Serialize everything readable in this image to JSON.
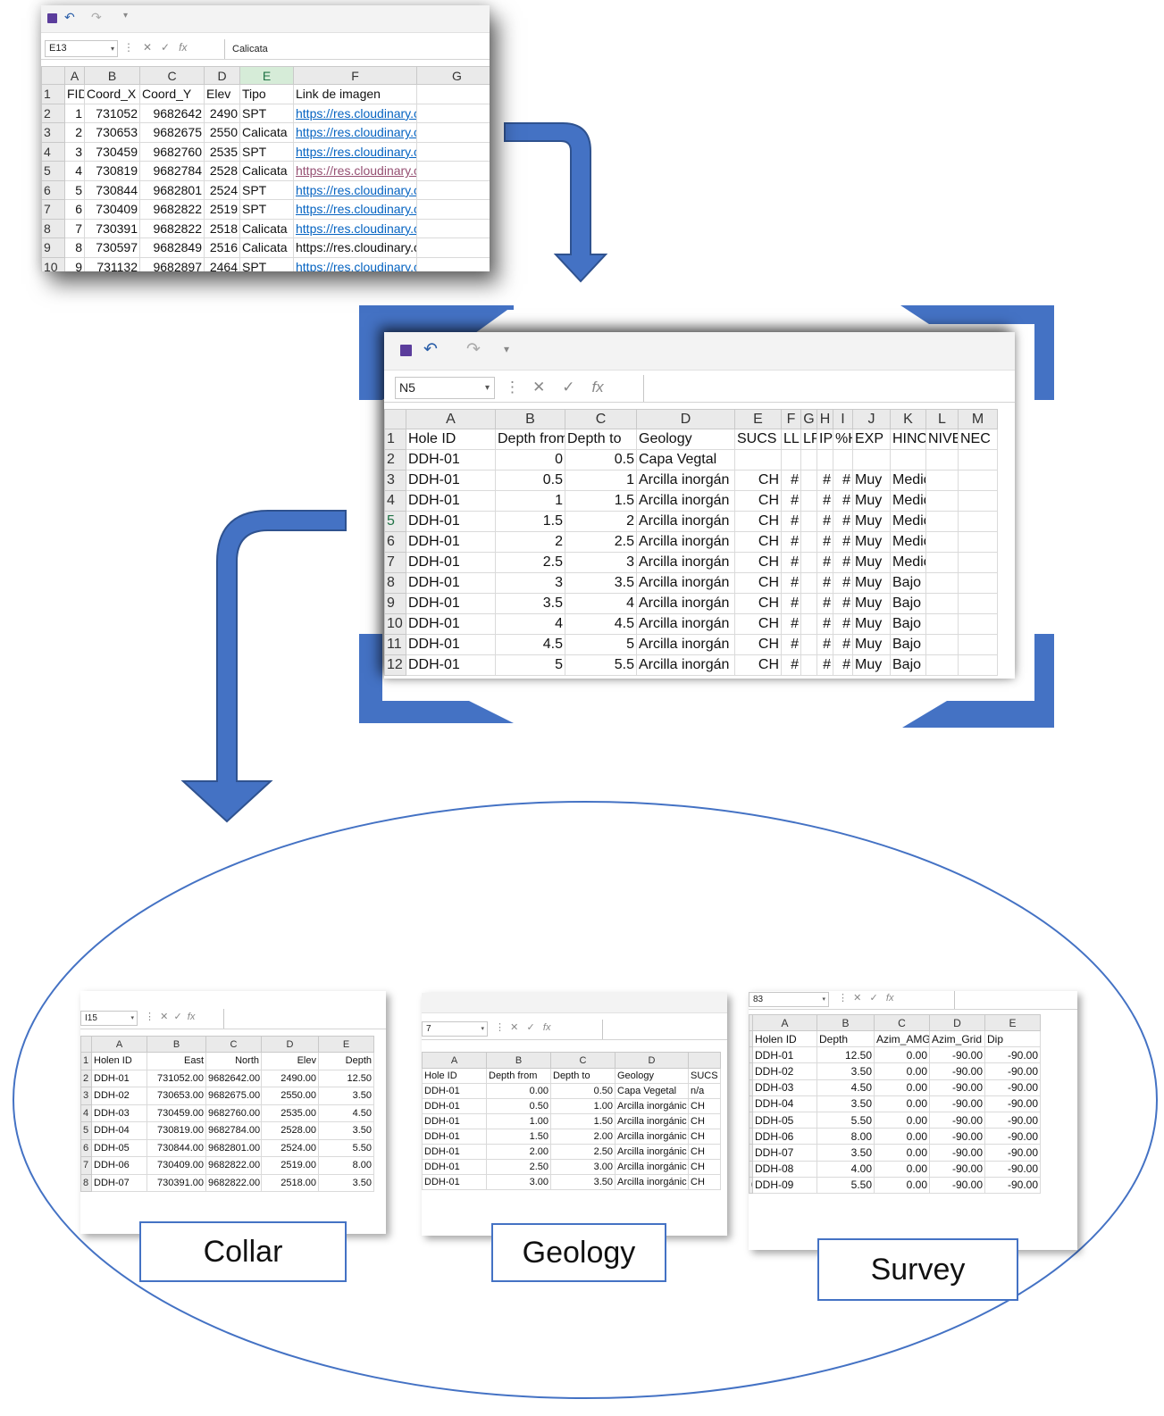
{
  "theme": {
    "arrow": "#4472c4",
    "arrow_outline": "#2f528f",
    "link": "#0563c1",
    "visited": "#954f72",
    "excel_green": "#217346"
  },
  "sheet1": {
    "namebox": "E13",
    "formula": "Calicata",
    "columns": [
      "A",
      "B",
      "C",
      "D",
      "E",
      "F",
      "G"
    ],
    "rows": [
      {
        "n": "1",
        "cells": [
          "FID",
          "Coord_X",
          "Coord_Y",
          "Elev",
          "Tipo",
          "Link de imagen",
          ""
        ]
      },
      {
        "n": "2",
        "cells": [
          "1",
          "731052",
          "9682642",
          "2490",
          "SPT",
          "https://res.cloudinary.com/dkfle",
          ""
        ]
      },
      {
        "n": "3",
        "cells": [
          "2",
          "730653",
          "9682675",
          "2550",
          "Calicata",
          "https://res.cloudinary.com/dkfle",
          ""
        ]
      },
      {
        "n": "4",
        "cells": [
          "3",
          "730459",
          "9682760",
          "2535",
          "SPT",
          "https://res.cloudinary.com/dkfle",
          ""
        ]
      },
      {
        "n": "5",
        "cells": [
          "4",
          "730819",
          "9682784",
          "2528",
          "Calicata",
          "https://res.cloudinary.com/dkfle",
          ""
        ]
      },
      {
        "n": "6",
        "cells": [
          "5",
          "730844",
          "9682801",
          "2524",
          "SPT",
          "https://res.cloudinary.com/dkfle",
          ""
        ]
      },
      {
        "n": "7",
        "cells": [
          "6",
          "730409",
          "9682822",
          "2519",
          "SPT",
          "https://res.cloudinary.com/dkfle",
          ""
        ]
      },
      {
        "n": "8",
        "cells": [
          "7",
          "730391",
          "9682822",
          "2518",
          "Calicata",
          "https://res.cloudinary.com/dkfle",
          ""
        ]
      },
      {
        "n": "9",
        "cells": [
          "8",
          "730597",
          "9682849",
          "2516",
          "Calicata",
          "https://res.cloudinary.com/dkfle",
          ""
        ]
      },
      {
        "n": "10",
        "cells": [
          "9",
          "731132",
          "9682897",
          "2464",
          "SPT",
          "https://res.cloudinary.com/dkfle",
          ""
        ]
      }
    ]
  },
  "sheet2": {
    "namebox": "N5",
    "formula": "",
    "columns": [
      "A",
      "B",
      "C",
      "D",
      "E",
      "F",
      "G",
      "H",
      "I",
      "J",
      "K",
      "L",
      "M"
    ],
    "rows": [
      {
        "n": "1",
        "cells": [
          "Hole ID",
          "Depth from",
          "Depth to",
          "Geology",
          "SUCS",
          "LL",
          "LP",
          "IP",
          "%H",
          "EXP",
          "HINC",
          "NIVE",
          "NEC"
        ]
      },
      {
        "n": "2",
        "cells": [
          "DDH-01",
          "0",
          "0.5",
          "Capa Vegtal",
          "",
          "",
          "",
          "",
          "",
          "",
          "",
          "",
          ""
        ]
      },
      {
        "n": "3",
        "cells": [
          "DDH-01",
          "0.5",
          "1",
          "Arcilla inorgán",
          "CH",
          "#",
          "",
          "#",
          "#",
          "Muy",
          "Medio",
          "",
          ""
        ]
      },
      {
        "n": "4",
        "cells": [
          "DDH-01",
          "1",
          "1.5",
          "Arcilla inorgán",
          "CH",
          "#",
          "",
          "#",
          "#",
          "Muy",
          "Medio",
          "",
          ""
        ]
      },
      {
        "n": "5",
        "cells": [
          "DDH-01",
          "1.5",
          "2",
          "Arcilla inorgán",
          "CH",
          "#",
          "",
          "#",
          "#",
          "Muy",
          "Medio",
          "",
          ""
        ]
      },
      {
        "n": "6",
        "cells": [
          "DDH-01",
          "2",
          "2.5",
          "Arcilla inorgán",
          "CH",
          "#",
          "",
          "#",
          "#",
          "Muy",
          "Medio",
          "",
          ""
        ]
      },
      {
        "n": "7",
        "cells": [
          "DDH-01",
          "2.5",
          "3",
          "Arcilla inorgán",
          "CH",
          "#",
          "",
          "#",
          "#",
          "Muy",
          "Medio",
          "",
          ""
        ]
      },
      {
        "n": "8",
        "cells": [
          "DDH-01",
          "3",
          "3.5",
          "Arcilla inorgán",
          "CH",
          "#",
          "",
          "#",
          "#",
          "Muy",
          "Bajo",
          "",
          ""
        ]
      },
      {
        "n": "9",
        "cells": [
          "DDH-01",
          "3.5",
          "4",
          "Arcilla inorgán",
          "CH",
          "#",
          "",
          "#",
          "#",
          "Muy",
          "Bajo",
          "",
          ""
        ]
      },
      {
        "n": "10",
        "cells": [
          "DDH-01",
          "4",
          "4.5",
          "Arcilla inorgán",
          "CH",
          "#",
          "",
          "#",
          "#",
          "Muy",
          "Bajo",
          "",
          ""
        ]
      },
      {
        "n": "11",
        "cells": [
          "DDH-01",
          "4.5",
          "5",
          "Arcilla inorgán",
          "CH",
          "#",
          "",
          "#",
          "#",
          "Muy",
          "Bajo",
          "",
          ""
        ]
      },
      {
        "n": "12",
        "cells": [
          "DDH-01",
          "5",
          "5.5",
          "Arcilla inorgán",
          "CH",
          "#",
          "",
          "#",
          "#",
          "Muy",
          "Bajo",
          "",
          ""
        ]
      }
    ]
  },
  "collar": {
    "label": "Collar",
    "namebox": "I15",
    "columns": [
      "A",
      "B",
      "C",
      "D",
      "E"
    ],
    "rows": [
      {
        "n": "1",
        "cells": [
          "Holen ID",
          "East",
          "North",
          "Elev",
          "Depth"
        ]
      },
      {
        "n": "2",
        "cells": [
          "DDH-01",
          "731052.00",
          "9682642.00",
          "2490.00",
          "12.50"
        ]
      },
      {
        "n": "3",
        "cells": [
          "DDH-02",
          "730653.00",
          "9682675.00",
          "2550.00",
          "3.50"
        ]
      },
      {
        "n": "4",
        "cells": [
          "DDH-03",
          "730459.00",
          "9682760.00",
          "2535.00",
          "4.50"
        ]
      },
      {
        "n": "5",
        "cells": [
          "DDH-04",
          "730819.00",
          "9682784.00",
          "2528.00",
          "3.50"
        ]
      },
      {
        "n": "6",
        "cells": [
          "DDH-05",
          "730844.00",
          "9682801.00",
          "2524.00",
          "5.50"
        ]
      },
      {
        "n": "7",
        "cells": [
          "DDH-06",
          "730409.00",
          "9682822.00",
          "2519.00",
          "8.00"
        ]
      },
      {
        "n": "8",
        "cells": [
          "DDH-07",
          "730391.00",
          "9682822.00",
          "2518.00",
          "3.50"
        ]
      }
    ]
  },
  "geology": {
    "label": "Geology",
    "namebox": "7",
    "columns": [
      "A",
      "B",
      "C",
      "D",
      ""
    ],
    "rows": [
      {
        "n": "",
        "cells": [
          "Hole ID",
          "Depth from",
          "Depth to",
          "Geology",
          "SUCS"
        ]
      },
      {
        "n": "",
        "cells": [
          "DDH-01",
          "0.00",
          "0.50",
          "Capa Vegetal",
          "n/a"
        ]
      },
      {
        "n": "",
        "cells": [
          "DDH-01",
          "0.50",
          "1.00",
          "Arcilla inorgánic",
          "CH"
        ]
      },
      {
        "n": "",
        "cells": [
          "DDH-01",
          "1.00",
          "1.50",
          "Arcilla inorgánic",
          "CH"
        ]
      },
      {
        "n": "",
        "cells": [
          "DDH-01",
          "1.50",
          "2.00",
          "Arcilla inorgánic",
          "CH"
        ]
      },
      {
        "n": "",
        "cells": [
          "DDH-01",
          "2.00",
          "2.50",
          "Arcilla inorgánic",
          "CH"
        ]
      },
      {
        "n": "",
        "cells": [
          "DDH-01",
          "2.50",
          "3.00",
          "Arcilla inorgánic",
          "CH"
        ]
      },
      {
        "n": "",
        "cells": [
          "DDH-01",
          "3.00",
          "3.50",
          "Arcilla inorgánic",
          "CH"
        ]
      }
    ]
  },
  "survey": {
    "label": "Survey",
    "namebox": "83",
    "columns": [
      "A",
      "B",
      "C",
      "D",
      "E"
    ],
    "rows": [
      {
        "n": "",
        "cells": [
          "Holen ID",
          "Depth",
          "Azim_AMG",
          "Azim_Grid",
          "Dip"
        ]
      },
      {
        "n": "",
        "cells": [
          "DDH-01",
          "12.50",
          "0.00",
          "-90.00",
          "-90.00"
        ]
      },
      {
        "n": "",
        "cells": [
          "DDH-02",
          "3.50",
          "0.00",
          "-90.00",
          "-90.00"
        ]
      },
      {
        "n": "",
        "cells": [
          "DDH-03",
          "4.50",
          "0.00",
          "-90.00",
          "-90.00"
        ]
      },
      {
        "n": "",
        "cells": [
          "DDH-04",
          "3.50",
          "0.00",
          "-90.00",
          "-90.00"
        ]
      },
      {
        "n": "",
        "cells": [
          "DDH-05",
          "5.50",
          "0.00",
          "-90.00",
          "-90.00"
        ]
      },
      {
        "n": "",
        "cells": [
          "DDH-06",
          "8.00",
          "0.00",
          "-90.00",
          "-90.00"
        ]
      },
      {
        "n": "",
        "cells": [
          "DDH-07",
          "3.50",
          "0.00",
          "-90.00",
          "-90.00"
        ]
      },
      {
        "n": "",
        "cells": [
          "DDH-08",
          "4.00",
          "0.00",
          "-90.00",
          "-90.00"
        ]
      },
      {
        "n": "0",
        "cells": [
          "DDH-09",
          "5.50",
          "0.00",
          "-90.00",
          "-90.00"
        ]
      }
    ]
  }
}
